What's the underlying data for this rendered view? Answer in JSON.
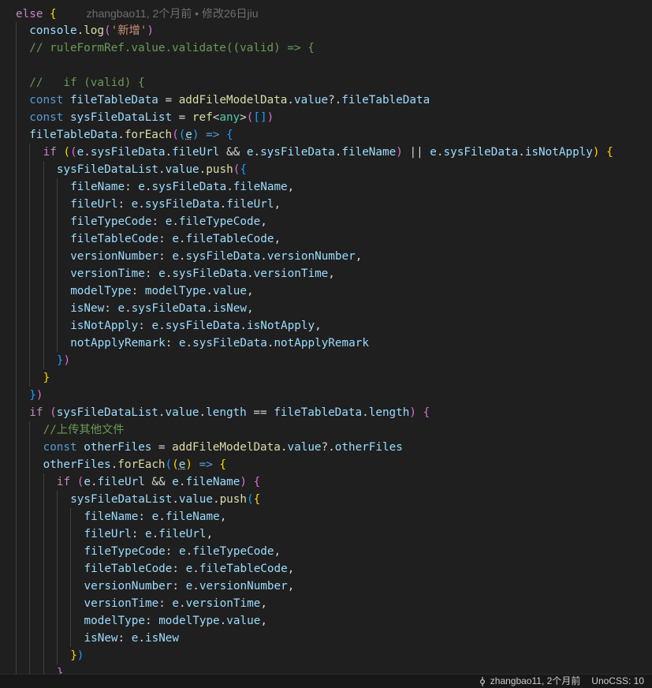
{
  "editor": {
    "blame_inline": "zhangbao11, 2个月前 • 修改26日jiu"
  },
  "status_bar": {
    "git_blame": "zhangbao11, 2个月前",
    "unocss": "UnoCSS: 10"
  },
  "code_lines": [
    {
      "indent": 1,
      "tokens": [
        [
          "kw",
          "else"
        ],
        [
          "pn",
          " "
        ],
        [
          "b1",
          "{"
        ]
      ],
      "blame": true
    },
    {
      "indent": 2,
      "tokens": [
        [
          "vr",
          "console"
        ],
        [
          "pn",
          "."
        ],
        [
          "fn",
          "log"
        ],
        [
          "b2",
          "("
        ],
        [
          "st",
          "'新增'"
        ],
        [
          "b2",
          ")"
        ]
      ]
    },
    {
      "indent": 2,
      "tokens": [
        [
          "cm",
          "// ruleFormRef.value.validate((valid) => {"
        ]
      ]
    },
    {
      "indent": 2,
      "tokens": []
    },
    {
      "indent": 2,
      "tokens": [
        [
          "cm",
          "//   if (valid) {"
        ]
      ]
    },
    {
      "indent": 2,
      "tokens": [
        [
          "kb",
          "const"
        ],
        [
          "pn",
          " "
        ],
        [
          "vr",
          "fileTableData"
        ],
        [
          "pn",
          " = "
        ],
        [
          "fn",
          "addFileModelData"
        ],
        [
          "pn",
          "."
        ],
        [
          "vr",
          "value"
        ],
        [
          "pn",
          "?."
        ],
        [
          "vr",
          "fileTableData"
        ]
      ]
    },
    {
      "indent": 2,
      "tokens": [
        [
          "kb",
          "const"
        ],
        [
          "pn",
          " "
        ],
        [
          "vr",
          "sysFileDataList"
        ],
        [
          "pn",
          " = "
        ],
        [
          "fn",
          "ref"
        ],
        [
          "pn",
          "<"
        ],
        [
          "ty",
          "any"
        ],
        [
          "pn",
          ">"
        ],
        [
          "b2",
          "("
        ],
        [
          "b3",
          "[]"
        ],
        [
          "b2",
          ")"
        ]
      ]
    },
    {
      "indent": 2,
      "tokens": [
        [
          "vr",
          "fileTableData"
        ],
        [
          "pn",
          "."
        ],
        [
          "fn",
          "forEach"
        ],
        [
          "b2",
          "("
        ],
        [
          "b3",
          "("
        ],
        [
          "vr sq",
          "e"
        ],
        [
          "b3",
          ")"
        ],
        [
          "pn",
          " "
        ],
        [
          "kb",
          "=>"
        ],
        [
          "pn",
          " "
        ],
        [
          "b3",
          "{"
        ]
      ]
    },
    {
      "indent": 3,
      "tokens": [
        [
          "kw",
          "if"
        ],
        [
          "pn",
          " "
        ],
        [
          "b1",
          "("
        ],
        [
          "b2",
          "("
        ],
        [
          "vr",
          "e"
        ],
        [
          "pn",
          "."
        ],
        [
          "vr",
          "sysFileData"
        ],
        [
          "pn",
          "."
        ],
        [
          "vr",
          "fileUrl"
        ],
        [
          "pn",
          " && "
        ],
        [
          "vr",
          "e"
        ],
        [
          "pn",
          "."
        ],
        [
          "vr",
          "sysFileData"
        ],
        [
          "pn",
          "."
        ],
        [
          "vr",
          "fileName"
        ],
        [
          "b2",
          ")"
        ],
        [
          "pn",
          " || "
        ],
        [
          "vr",
          "e"
        ],
        [
          "pn",
          "."
        ],
        [
          "vr",
          "sysFileData"
        ],
        [
          "pn",
          "."
        ],
        [
          "vr",
          "isNotApply"
        ],
        [
          "b1",
          ")"
        ],
        [
          "pn",
          " "
        ],
        [
          "b1",
          "{"
        ]
      ]
    },
    {
      "indent": 4,
      "tokens": [
        [
          "vr",
          "sysFileDataList"
        ],
        [
          "pn",
          "."
        ],
        [
          "vr",
          "value"
        ],
        [
          "pn",
          "."
        ],
        [
          "fn",
          "push"
        ],
        [
          "b2",
          "("
        ],
        [
          "b3",
          "{"
        ]
      ]
    },
    {
      "indent": 5,
      "tokens": [
        [
          "vr",
          "fileName"
        ],
        [
          "pn",
          ": "
        ],
        [
          "vr",
          "e"
        ],
        [
          "pn",
          "."
        ],
        [
          "vr",
          "sysFileData"
        ],
        [
          "pn",
          "."
        ],
        [
          "vr",
          "fileName"
        ],
        [
          "pn",
          ","
        ]
      ]
    },
    {
      "indent": 5,
      "tokens": [
        [
          "vr",
          "fileUrl"
        ],
        [
          "pn",
          ": "
        ],
        [
          "vr",
          "e"
        ],
        [
          "pn",
          "."
        ],
        [
          "vr",
          "sysFileData"
        ],
        [
          "pn",
          "."
        ],
        [
          "vr",
          "fileUrl"
        ],
        [
          "pn",
          ","
        ]
      ]
    },
    {
      "indent": 5,
      "tokens": [
        [
          "vr",
          "fileTypeCode"
        ],
        [
          "pn",
          ": "
        ],
        [
          "vr",
          "e"
        ],
        [
          "pn",
          "."
        ],
        [
          "vr",
          "fileTypeCode"
        ],
        [
          "pn",
          ","
        ]
      ]
    },
    {
      "indent": 5,
      "tokens": [
        [
          "vr",
          "fileTableCode"
        ],
        [
          "pn",
          ": "
        ],
        [
          "vr",
          "e"
        ],
        [
          "pn",
          "."
        ],
        [
          "vr",
          "fileTableCode"
        ],
        [
          "pn",
          ","
        ]
      ]
    },
    {
      "indent": 5,
      "tokens": [
        [
          "vr",
          "versionNumber"
        ],
        [
          "pn",
          ": "
        ],
        [
          "vr",
          "e"
        ],
        [
          "pn",
          "."
        ],
        [
          "vr",
          "sysFileData"
        ],
        [
          "pn",
          "."
        ],
        [
          "vr",
          "versionNumber"
        ],
        [
          "pn",
          ","
        ]
      ]
    },
    {
      "indent": 5,
      "tokens": [
        [
          "vr",
          "versionTime"
        ],
        [
          "pn",
          ": "
        ],
        [
          "vr",
          "e"
        ],
        [
          "pn",
          "."
        ],
        [
          "vr",
          "sysFileData"
        ],
        [
          "pn",
          "."
        ],
        [
          "vr",
          "versionTime"
        ],
        [
          "pn",
          ","
        ]
      ]
    },
    {
      "indent": 5,
      "tokens": [
        [
          "vr",
          "modelType"
        ],
        [
          "pn",
          ": "
        ],
        [
          "vr",
          "modelType"
        ],
        [
          "pn",
          "."
        ],
        [
          "vr",
          "value"
        ],
        [
          "pn",
          ","
        ]
      ]
    },
    {
      "indent": 5,
      "tokens": [
        [
          "vr",
          "isNew"
        ],
        [
          "pn",
          ": "
        ],
        [
          "vr",
          "e"
        ],
        [
          "pn",
          "."
        ],
        [
          "vr",
          "sysFileData"
        ],
        [
          "pn",
          "."
        ],
        [
          "vr",
          "isNew"
        ],
        [
          "pn",
          ","
        ]
      ]
    },
    {
      "indent": 5,
      "tokens": [
        [
          "vr",
          "isNotApply"
        ],
        [
          "pn",
          ": "
        ],
        [
          "vr",
          "e"
        ],
        [
          "pn",
          "."
        ],
        [
          "vr",
          "sysFileData"
        ],
        [
          "pn",
          "."
        ],
        [
          "vr",
          "isNotApply"
        ],
        [
          "pn",
          ","
        ]
      ]
    },
    {
      "indent": 5,
      "tokens": [
        [
          "vr",
          "notApplyRemark"
        ],
        [
          "pn",
          ": "
        ],
        [
          "vr",
          "e"
        ],
        [
          "pn",
          "."
        ],
        [
          "vr",
          "sysFileData"
        ],
        [
          "pn",
          "."
        ],
        [
          "vr",
          "notApplyRemark"
        ]
      ]
    },
    {
      "indent": 4,
      "tokens": [
        [
          "b3",
          "}"
        ],
        [
          "b2",
          ")"
        ]
      ]
    },
    {
      "indent": 3,
      "tokens": [
        [
          "b1",
          "}"
        ]
      ]
    },
    {
      "indent": 2,
      "tokens": [
        [
          "b3",
          "}"
        ],
        [
          "b2",
          ")"
        ]
      ]
    },
    {
      "indent": 2,
      "tokens": [
        [
          "kw",
          "if"
        ],
        [
          "pn",
          " "
        ],
        [
          "b2",
          "("
        ],
        [
          "vr",
          "sysFileDataList"
        ],
        [
          "pn",
          "."
        ],
        [
          "vr",
          "value"
        ],
        [
          "pn",
          "."
        ],
        [
          "vr",
          "length"
        ],
        [
          "pn",
          " == "
        ],
        [
          "vr",
          "fileTableData"
        ],
        [
          "pn",
          "."
        ],
        [
          "vr",
          "length"
        ],
        [
          "b2",
          ")"
        ],
        [
          "pn",
          " "
        ],
        [
          "b2",
          "{"
        ]
      ]
    },
    {
      "indent": 3,
      "tokens": [
        [
          "cm",
          "//上传其他文件"
        ]
      ]
    },
    {
      "indent": 3,
      "tokens": [
        [
          "kb",
          "const"
        ],
        [
          "pn",
          " "
        ],
        [
          "vr",
          "otherFiles"
        ],
        [
          "pn",
          " = "
        ],
        [
          "fn",
          "addFileModelData"
        ],
        [
          "pn",
          "."
        ],
        [
          "vr",
          "value"
        ],
        [
          "pn",
          "?."
        ],
        [
          "vr",
          "otherFiles"
        ]
      ]
    },
    {
      "indent": 3,
      "tokens": [
        [
          "vr",
          "otherFiles"
        ],
        [
          "pn",
          "."
        ],
        [
          "fn",
          "forEach"
        ],
        [
          "b3",
          "("
        ],
        [
          "b1",
          "("
        ],
        [
          "vr sq",
          "e"
        ],
        [
          "b1",
          ")"
        ],
        [
          "pn",
          " "
        ],
        [
          "kb",
          "=>"
        ],
        [
          "pn",
          " "
        ],
        [
          "b1",
          "{"
        ]
      ]
    },
    {
      "indent": 4,
      "tokens": [
        [
          "kw",
          "if"
        ],
        [
          "pn",
          " "
        ],
        [
          "b2",
          "("
        ],
        [
          "vr",
          "e"
        ],
        [
          "pn",
          "."
        ],
        [
          "vr",
          "fileUrl"
        ],
        [
          "pn",
          " && "
        ],
        [
          "vr",
          "e"
        ],
        [
          "pn",
          "."
        ],
        [
          "vr",
          "fileName"
        ],
        [
          "b2",
          ")"
        ],
        [
          "pn",
          " "
        ],
        [
          "b2",
          "{"
        ]
      ]
    },
    {
      "indent": 5,
      "tokens": [
        [
          "vr",
          "sysFileDataList"
        ],
        [
          "pn",
          "."
        ],
        [
          "vr",
          "value"
        ],
        [
          "pn",
          "."
        ],
        [
          "fn",
          "push"
        ],
        [
          "b3",
          "("
        ],
        [
          "b1",
          "{"
        ]
      ]
    },
    {
      "indent": 6,
      "tokens": [
        [
          "vr",
          "fileName"
        ],
        [
          "pn",
          ": "
        ],
        [
          "vr",
          "e"
        ],
        [
          "pn",
          "."
        ],
        [
          "vr",
          "fileName"
        ],
        [
          "pn",
          ","
        ]
      ]
    },
    {
      "indent": 6,
      "tokens": [
        [
          "vr",
          "fileUrl"
        ],
        [
          "pn",
          ": "
        ],
        [
          "vr",
          "e"
        ],
        [
          "pn",
          "."
        ],
        [
          "vr",
          "fileUrl"
        ],
        [
          "pn",
          ","
        ]
      ]
    },
    {
      "indent": 6,
      "tokens": [
        [
          "vr",
          "fileTypeCode"
        ],
        [
          "pn",
          ": "
        ],
        [
          "vr",
          "e"
        ],
        [
          "pn",
          "."
        ],
        [
          "vr",
          "fileTypeCode"
        ],
        [
          "pn",
          ","
        ]
      ]
    },
    {
      "indent": 6,
      "tokens": [
        [
          "vr",
          "fileTableCode"
        ],
        [
          "pn",
          ": "
        ],
        [
          "vr",
          "e"
        ],
        [
          "pn",
          "."
        ],
        [
          "vr",
          "fileTableCode"
        ],
        [
          "pn",
          ","
        ]
      ]
    },
    {
      "indent": 6,
      "tokens": [
        [
          "vr",
          "versionNumber"
        ],
        [
          "pn",
          ": "
        ],
        [
          "vr",
          "e"
        ],
        [
          "pn",
          "."
        ],
        [
          "vr",
          "versionNumber"
        ],
        [
          "pn",
          ","
        ]
      ]
    },
    {
      "indent": 6,
      "tokens": [
        [
          "vr",
          "versionTime"
        ],
        [
          "pn",
          ": "
        ],
        [
          "vr",
          "e"
        ],
        [
          "pn",
          "."
        ],
        [
          "vr",
          "versionTime"
        ],
        [
          "pn",
          ","
        ]
      ]
    },
    {
      "indent": 6,
      "tokens": [
        [
          "vr",
          "modelType"
        ],
        [
          "pn",
          ": "
        ],
        [
          "vr",
          "modelType"
        ],
        [
          "pn",
          "."
        ],
        [
          "vr",
          "value"
        ],
        [
          "pn",
          ","
        ]
      ]
    },
    {
      "indent": 6,
      "tokens": [
        [
          "vr",
          "isNew"
        ],
        [
          "pn",
          ": "
        ],
        [
          "vr",
          "e"
        ],
        [
          "pn",
          "."
        ],
        [
          "vr",
          "isNew"
        ]
      ]
    },
    {
      "indent": 5,
      "tokens": [
        [
          "b1",
          "}"
        ],
        [
          "b3",
          ")"
        ]
      ]
    },
    {
      "indent": 4,
      "tokens": [
        [
          "b2",
          "}"
        ]
      ]
    }
  ]
}
